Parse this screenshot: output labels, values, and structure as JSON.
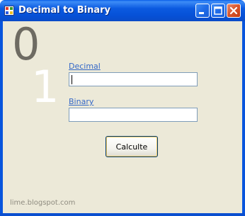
{
  "window": {
    "title": "Decimal to Binary",
    "icon": "app-window-icon",
    "controls": {
      "minimize_icon": "minimize-icon",
      "maximize_icon": "maximize-icon",
      "close_icon": "close-icon"
    }
  },
  "decoration": {
    "big_zero": "0",
    "big_one": "1"
  },
  "form": {
    "decimal_label": "Decimal",
    "decimal_value": "",
    "binary_label": "Binary",
    "binary_value": "",
    "calculate_button": "Calculte"
  },
  "footer": {
    "credit": "lime.blogspot.com"
  },
  "colors": {
    "titlebar": "#0855dd",
    "client_background": "#ece9d8",
    "link": "#3468c8",
    "close_button": "#d8552c"
  }
}
